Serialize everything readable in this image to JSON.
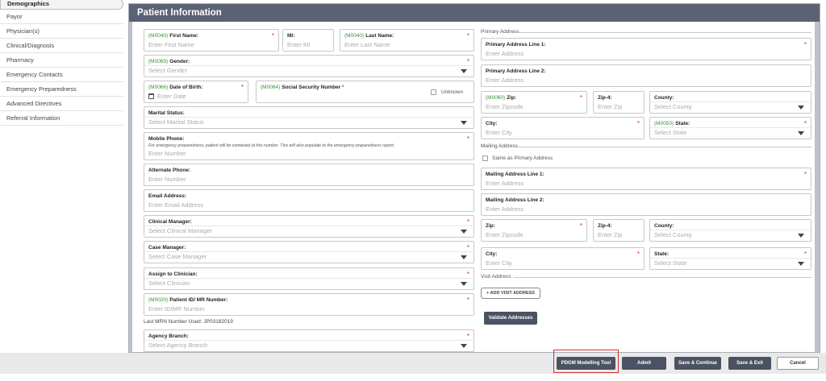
{
  "sidebar": {
    "items": [
      {
        "label": "Demographics"
      },
      {
        "label": "Payor"
      },
      {
        "label": "Physician(s)"
      },
      {
        "label": "Clinical/Diagnosis"
      },
      {
        "label": "Pharmacy"
      },
      {
        "label": "Emergency Contacts"
      },
      {
        "label": "Emergency Preparedness"
      },
      {
        "label": "Advanced Directives"
      },
      {
        "label": "Referral Information"
      }
    ]
  },
  "panel": {
    "title": "Patient Information"
  },
  "left": {
    "first_name": {
      "code": "(M0040)",
      "label": "First Name:",
      "placeholder": "Enter First Name"
    },
    "mi": {
      "label": "MI:",
      "placeholder": "Enter MI"
    },
    "last_name": {
      "code": "(M0040)",
      "label": "Last Name:",
      "placeholder": "Enter Last Name"
    },
    "gender": {
      "code": "(M0069)",
      "label": "Gender:",
      "placeholder": "Select Gender"
    },
    "dob": {
      "code": "(M0066)",
      "label": "Date of Birth:",
      "placeholder": "Enter Date"
    },
    "ssn": {
      "code": "(M0064)",
      "label": "Social Security Number",
      "unknown_label": "Unknown"
    },
    "marital": {
      "label": "Marital Status:",
      "placeholder": "Select Marital Status"
    },
    "mobile": {
      "label": "Mobile Phone:",
      "hint": "For emergency preparedness, patient will be contacted at this number. This will also populate to the emergency preparedness report.",
      "placeholder": "Enter Number"
    },
    "alt_phone": {
      "label": "Alternate Phone:",
      "placeholder": "Enter Number"
    },
    "email": {
      "label": "Email Address:",
      "placeholder": "Enter Email Address"
    },
    "clinical_manager": {
      "label": "Clinical Manager:",
      "placeholder": "Select Clinical Manager"
    },
    "case_manager": {
      "label": "Case Manager:",
      "placeholder": "Select Case Manager"
    },
    "clinician": {
      "label": "Assign to Clinician:",
      "placeholder": "Select Clinician"
    },
    "patient_id": {
      "code": "(M0020)",
      "label": "Patient ID/ MR Number:",
      "placeholder": "Enter ID/MR Number"
    },
    "last_mrn": "Last MRN Number Used: JP03182019",
    "agency_branch": {
      "label": "Agency Branch:",
      "placeholder": "Select Agency Branch"
    }
  },
  "right": {
    "primary_heading": "Primary Address",
    "primary_line1": {
      "label": "Primary Address Line 1:",
      "placeholder": "Enter Address"
    },
    "primary_line2": {
      "label": "Primary Address Line 2:",
      "placeholder": "Enter Address"
    },
    "primary_zip": {
      "code": "(M0060)",
      "label": "Zip:",
      "placeholder": "Enter Zipcode"
    },
    "primary_zip4": {
      "label": "Zip-4:",
      "placeholder": "Enter Zip"
    },
    "primary_county": {
      "label": "County:",
      "placeholder": "Select County"
    },
    "primary_city": {
      "label": "City:",
      "placeholder": "Enter City"
    },
    "primary_state": {
      "code": "(M0050)",
      "label": "State:",
      "placeholder": "Select State"
    },
    "mailing_heading": "Mailing Address",
    "same_as_primary": "Same as Primary Address",
    "mailing_line1": {
      "label": "Mailing Address Line 1:",
      "placeholder": "Enter Address"
    },
    "mailing_line2": {
      "label": "Mailing Address Line 2:",
      "placeholder": "Enter Address"
    },
    "mailing_zip": {
      "label": "Zip:",
      "placeholder": "Enter Zipcode"
    },
    "mailing_zip4": {
      "label": "Zip-4:",
      "placeholder": "Enter Zip"
    },
    "mailing_county": {
      "label": "County:",
      "placeholder": "Select County"
    },
    "mailing_city": {
      "label": "City:",
      "placeholder": "Enter City"
    },
    "mailing_state": {
      "label": "State:",
      "placeholder": "Select State"
    },
    "visit_heading": "Visit Address",
    "add_visit": "+ ADD VISIT ADDRESS",
    "validate": "Validate Addresses"
  },
  "footer": {
    "pdgm": "PDGM Modelling Tool",
    "admit": "Admit",
    "save_continue": "Save & Continue",
    "save_exit": "Save & Exit",
    "cancel": "Cancel"
  },
  "required_mark": "*",
  "colors": {
    "header": "#5b6275",
    "code_green": "#3c8c3c",
    "required_red": "#d9302c",
    "button_dark": "#4b5263"
  }
}
